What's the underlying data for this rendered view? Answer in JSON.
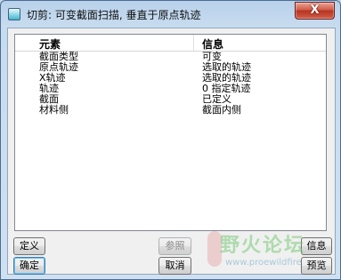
{
  "window": {
    "title": "切剪: 可变截面扫描, 垂直于原点轨迹",
    "close_label": "X"
  },
  "table": {
    "headers": {
      "element": "元素",
      "info": "信息"
    },
    "rows": [
      {
        "element": "截面类型",
        "info": "可变"
      },
      {
        "element": "原点轨迹",
        "info": "选取的轨迹"
      },
      {
        "element": "X轨迹",
        "info": "选取的轨迹"
      },
      {
        "element": "轨迹",
        "info": "0 指定轨迹"
      },
      {
        "element": "截面",
        "info": "已定义"
      },
      {
        "element": "材料侧",
        "info": "截面内侧"
      }
    ]
  },
  "buttons": {
    "define": "定义",
    "reference": "参照",
    "info": "信息",
    "ok": "确定",
    "cancel": "取消",
    "preview": "预览"
  },
  "watermark": {
    "text": "野火论坛",
    "url": "www.proewildfire"
  },
  "colors": {
    "titlebar": "#c8dcef",
    "close_button": "#c7412d",
    "dialog_bg": "#f0f0f0"
  }
}
